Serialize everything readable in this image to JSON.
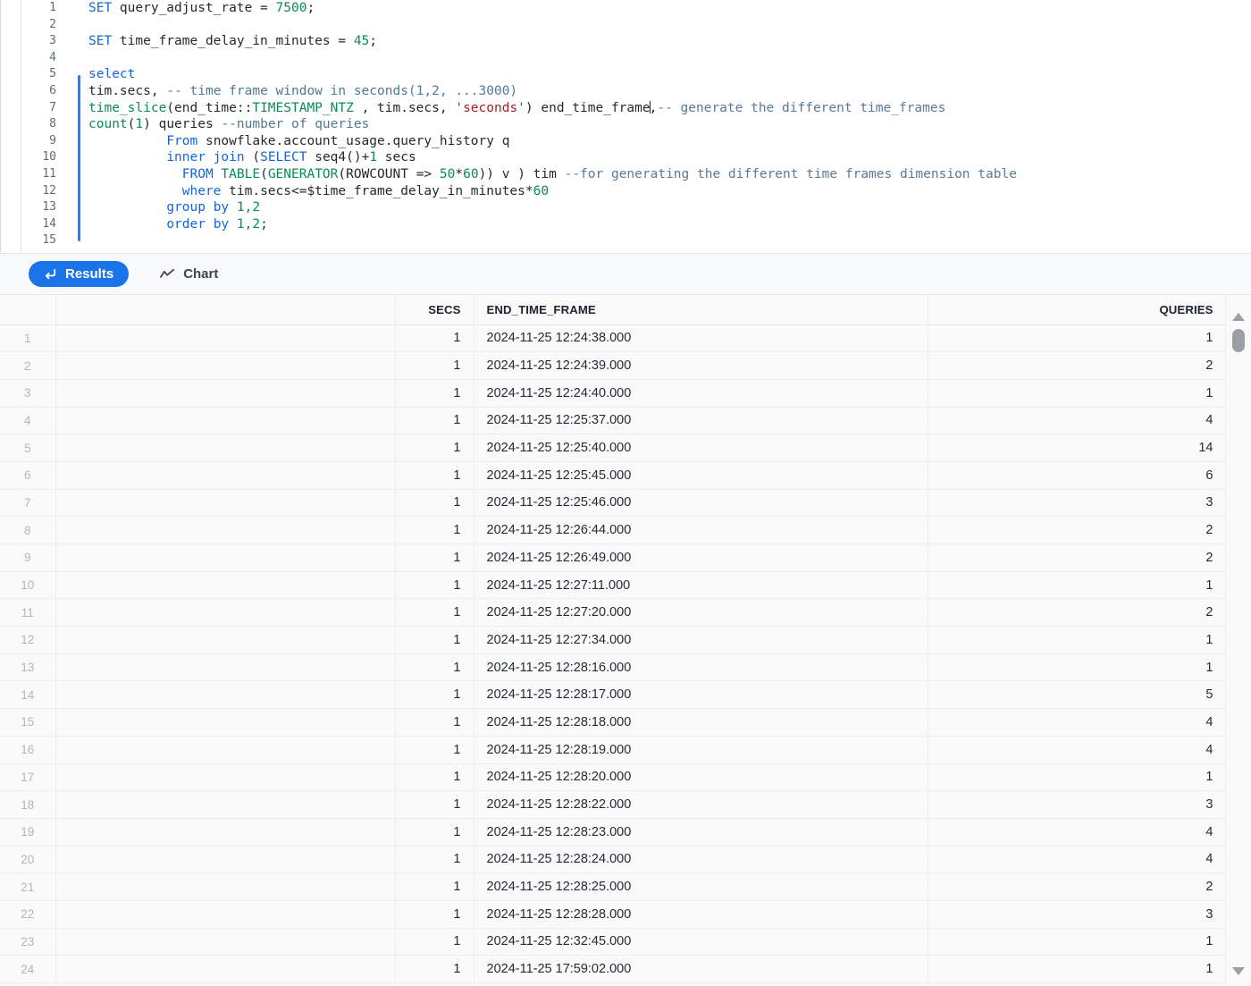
{
  "editor": {
    "total_lines": 15,
    "highlighted_statement_lines": [
      5,
      14
    ],
    "lines": [
      {
        "n": "1",
        "tokens": [
          {
            "t": "SET ",
            "c": "kw"
          },
          {
            "t": "query_adjust_rate = ",
            "c": "plain"
          },
          {
            "t": "7500",
            "c": "num"
          },
          {
            "t": ";",
            "c": "plain"
          }
        ]
      },
      {
        "n": "2",
        "tokens": []
      },
      {
        "n": "3",
        "tokens": [
          {
            "t": "SET ",
            "c": "kw"
          },
          {
            "t": "time_frame_delay_in_minutes = ",
            "c": "plain"
          },
          {
            "t": "45",
            "c": "num"
          },
          {
            "t": ";",
            "c": "plain"
          }
        ]
      },
      {
        "n": "4",
        "tokens": []
      },
      {
        "n": "5",
        "tokens": [
          {
            "t": "select",
            "c": "kw"
          }
        ]
      },
      {
        "n": "6",
        "tokens": [
          {
            "t": "tim.secs, ",
            "c": "plain"
          },
          {
            "t": "-- time frame window in seconds(1,2, ...3000)",
            "c": "cmt"
          }
        ]
      },
      {
        "n": "7",
        "tokens": [
          {
            "t": "time_slice",
            "c": "fn"
          },
          {
            "t": "(end_time::",
            "c": "plain"
          },
          {
            "t": "TIMESTAMP_NTZ",
            "c": "type"
          },
          {
            "t": " , tim.secs, ",
            "c": "plain"
          },
          {
            "t": "'seconds'",
            "c": "str"
          },
          {
            "t": ") end_time_frame",
            "c": "plain"
          },
          {
            "t": "|CARET|",
            "c": "caret"
          },
          {
            "t": ",",
            "c": "plain"
          },
          {
            "t": "-- generate the different time_frames",
            "c": "cmt2"
          }
        ]
      },
      {
        "n": "8",
        "tokens": [
          {
            "t": "count",
            "c": "fn"
          },
          {
            "t": "(",
            "c": "plain"
          },
          {
            "t": "1",
            "c": "num"
          },
          {
            "t": ") queries ",
            "c": "plain"
          },
          {
            "t": "--number of queries",
            "c": "cmt"
          }
        ]
      },
      {
        "n": "9",
        "tokens": [
          {
            "t": "          ",
            "c": "plain"
          },
          {
            "t": "From",
            "c": "kw"
          },
          {
            "t": " snowflake.account_usage.query_history q",
            "c": "plain"
          }
        ]
      },
      {
        "n": "10",
        "tokens": [
          {
            "t": "          ",
            "c": "plain"
          },
          {
            "t": "inner join",
            "c": "kw"
          },
          {
            "t": " (",
            "c": "plain"
          },
          {
            "t": "SELECT",
            "c": "kw"
          },
          {
            "t": " seq4()+",
            "c": "plain"
          },
          {
            "t": "1",
            "c": "num"
          },
          {
            "t": " secs",
            "c": "plain"
          }
        ]
      },
      {
        "n": "11",
        "tokens": [
          {
            "t": "            ",
            "c": "plain"
          },
          {
            "t": "FROM",
            "c": "kw"
          },
          {
            "t": " ",
            "c": "plain"
          },
          {
            "t": "TABLE",
            "c": "fn"
          },
          {
            "t": "(",
            "c": "plain"
          },
          {
            "t": "GENERATOR",
            "c": "fn"
          },
          {
            "t": "(ROWCOUNT => ",
            "c": "plain"
          },
          {
            "t": "50",
            "c": "num"
          },
          {
            "t": "*",
            "c": "plain"
          },
          {
            "t": "60",
            "c": "num"
          },
          {
            "t": ")) v ) tim ",
            "c": "plain"
          },
          {
            "t": "--for generating the different time frames dimension table",
            "c": "cmt2"
          }
        ]
      },
      {
        "n": "12",
        "tokens": [
          {
            "t": "            ",
            "c": "plain"
          },
          {
            "t": "where",
            "c": "kw"
          },
          {
            "t": " tim.secs<=$time_frame_delay_in_minutes*",
            "c": "plain"
          },
          {
            "t": "60",
            "c": "num"
          }
        ]
      },
      {
        "n": "13",
        "tokens": [
          {
            "t": "          ",
            "c": "plain"
          },
          {
            "t": "group by",
            "c": "kw"
          },
          {
            "t": " ",
            "c": "plain"
          },
          {
            "t": "1,2",
            "c": "num"
          }
        ]
      },
      {
        "n": "14",
        "tokens": [
          {
            "t": "          ",
            "c": "plain"
          },
          {
            "t": "order by",
            "c": "kw"
          },
          {
            "t": " ",
            "c": "plain"
          },
          {
            "t": "1,2",
            "c": "num"
          },
          {
            "t": ";",
            "c": "plain"
          }
        ]
      },
      {
        "n": "15",
        "tokens": []
      }
    ]
  },
  "tabs": [
    {
      "id": "results",
      "label": "Results",
      "icon": "arrow-return-icon",
      "active": true
    },
    {
      "id": "chart",
      "label": "Chart",
      "icon": "line-chart-icon",
      "active": false
    }
  ],
  "results_table": {
    "columns": [
      "",
      "",
      "SECS",
      "END_TIME_FRAME",
      "QUERIES"
    ],
    "rows": [
      {
        "n": "1",
        "secs": "1",
        "end_time_frame": "2024-11-25 12:24:38.000",
        "queries": "1"
      },
      {
        "n": "2",
        "secs": "1",
        "end_time_frame": "2024-11-25 12:24:39.000",
        "queries": "2"
      },
      {
        "n": "3",
        "secs": "1",
        "end_time_frame": "2024-11-25 12:24:40.000",
        "queries": "1"
      },
      {
        "n": "4",
        "secs": "1",
        "end_time_frame": "2024-11-25 12:25:37.000",
        "queries": "4"
      },
      {
        "n": "5",
        "secs": "1",
        "end_time_frame": "2024-11-25 12:25:40.000",
        "queries": "14"
      },
      {
        "n": "6",
        "secs": "1",
        "end_time_frame": "2024-11-25 12:25:45.000",
        "queries": "6"
      },
      {
        "n": "7",
        "secs": "1",
        "end_time_frame": "2024-11-25 12:25:46.000",
        "queries": "3"
      },
      {
        "n": "8",
        "secs": "1",
        "end_time_frame": "2024-11-25 12:26:44.000",
        "queries": "2"
      },
      {
        "n": "9",
        "secs": "1",
        "end_time_frame": "2024-11-25 12:26:49.000",
        "queries": "2"
      },
      {
        "n": "10",
        "secs": "1",
        "end_time_frame": "2024-11-25 12:27:11.000",
        "queries": "1"
      },
      {
        "n": "11",
        "secs": "1",
        "end_time_frame": "2024-11-25 12:27:20.000",
        "queries": "2"
      },
      {
        "n": "12",
        "secs": "1",
        "end_time_frame": "2024-11-25 12:27:34.000",
        "queries": "1"
      },
      {
        "n": "13",
        "secs": "1",
        "end_time_frame": "2024-11-25 12:28:16.000",
        "queries": "1"
      },
      {
        "n": "14",
        "secs": "1",
        "end_time_frame": "2024-11-25 12:28:17.000",
        "queries": "5"
      },
      {
        "n": "15",
        "secs": "1",
        "end_time_frame": "2024-11-25 12:28:18.000",
        "queries": "4"
      },
      {
        "n": "16",
        "secs": "1",
        "end_time_frame": "2024-11-25 12:28:19.000",
        "queries": "4"
      },
      {
        "n": "17",
        "secs": "1",
        "end_time_frame": "2024-11-25 12:28:20.000",
        "queries": "1"
      },
      {
        "n": "18",
        "secs": "1",
        "end_time_frame": "2024-11-25 12:28:22.000",
        "queries": "3"
      },
      {
        "n": "19",
        "secs": "1",
        "end_time_frame": "2024-11-25 12:28:23.000",
        "queries": "4"
      },
      {
        "n": "20",
        "secs": "1",
        "end_time_frame": "2024-11-25 12:28:24.000",
        "queries": "4"
      },
      {
        "n": "21",
        "secs": "1",
        "end_time_frame": "2024-11-25 12:28:25.000",
        "queries": "2"
      },
      {
        "n": "22",
        "secs": "1",
        "end_time_frame": "2024-11-25 12:28:28.000",
        "queries": "3"
      },
      {
        "n": "23",
        "secs": "1",
        "end_time_frame": "2024-11-25 12:32:45.000",
        "queries": "1"
      },
      {
        "n": "24",
        "secs": "1",
        "end_time_frame": "2024-11-25 17:59:02.000",
        "queries": "1"
      }
    ]
  },
  "scrollbar": {
    "up_arrow": "scroll-up-arrow-icon",
    "down_arrow": "scroll-down-arrow-icon",
    "thumb": "scroll-thumb"
  },
  "colors": {
    "accent": "#1a73e8",
    "keyword": "#1565d8",
    "function": "#0a8c54",
    "string": "#a3222a",
    "comment": "#4f7a94",
    "statement_bar": "#2f7bff"
  }
}
